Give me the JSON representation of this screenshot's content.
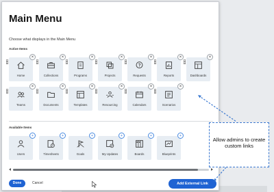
{
  "modal": {
    "title": "Main Menu",
    "subtitle": "Choose what displays in the Main Menu",
    "active_label": "Active Items",
    "available_label": "Available Items"
  },
  "active_items": [
    {
      "label": "Home",
      "icon": "home-icon"
    },
    {
      "label": "Collections",
      "icon": "briefcase-icon"
    },
    {
      "label": "Programs",
      "icon": "document-icon"
    },
    {
      "label": "Projects",
      "icon": "layers-icon"
    },
    {
      "label": "Requests",
      "icon": "question-bubble-icon"
    },
    {
      "label": "Reports",
      "icon": "chart-report-icon"
    },
    {
      "label": "Dashboards",
      "icon": "dashboard-icon"
    },
    {
      "label": "Teams",
      "icon": "team-icon"
    },
    {
      "label": "Documents",
      "icon": "folder-icon"
    },
    {
      "label": "Templates",
      "icon": "template-icon"
    },
    {
      "label": "Resourcing",
      "icon": "resourcing-icon"
    },
    {
      "label": "Calendars",
      "icon": "calendar-icon"
    },
    {
      "label": "Scenarios",
      "icon": "scenario-icon"
    }
  ],
  "available_items": [
    {
      "label": "Users",
      "icon": "user-icon"
    },
    {
      "label": "Timesheets",
      "icon": "timesheet-icon"
    },
    {
      "label": "Goals",
      "icon": "goal-flag-icon"
    },
    {
      "label": "My Updates",
      "icon": "updates-icon"
    },
    {
      "label": "Boards",
      "icon": "board-icon"
    },
    {
      "label": "Blueprints",
      "icon": "blueprint-icon"
    }
  ],
  "footer": {
    "done_label": "Done",
    "cancel_label": "Cancel",
    "external_link_label": "Add External Link"
  },
  "callout": {
    "line1": "Allow admins to create",
    "line2": "custom links"
  },
  "colors": {
    "accent": "#1f63d3",
    "tile_bg": "#e7edf3",
    "callout_border": "#3a78d0"
  }
}
